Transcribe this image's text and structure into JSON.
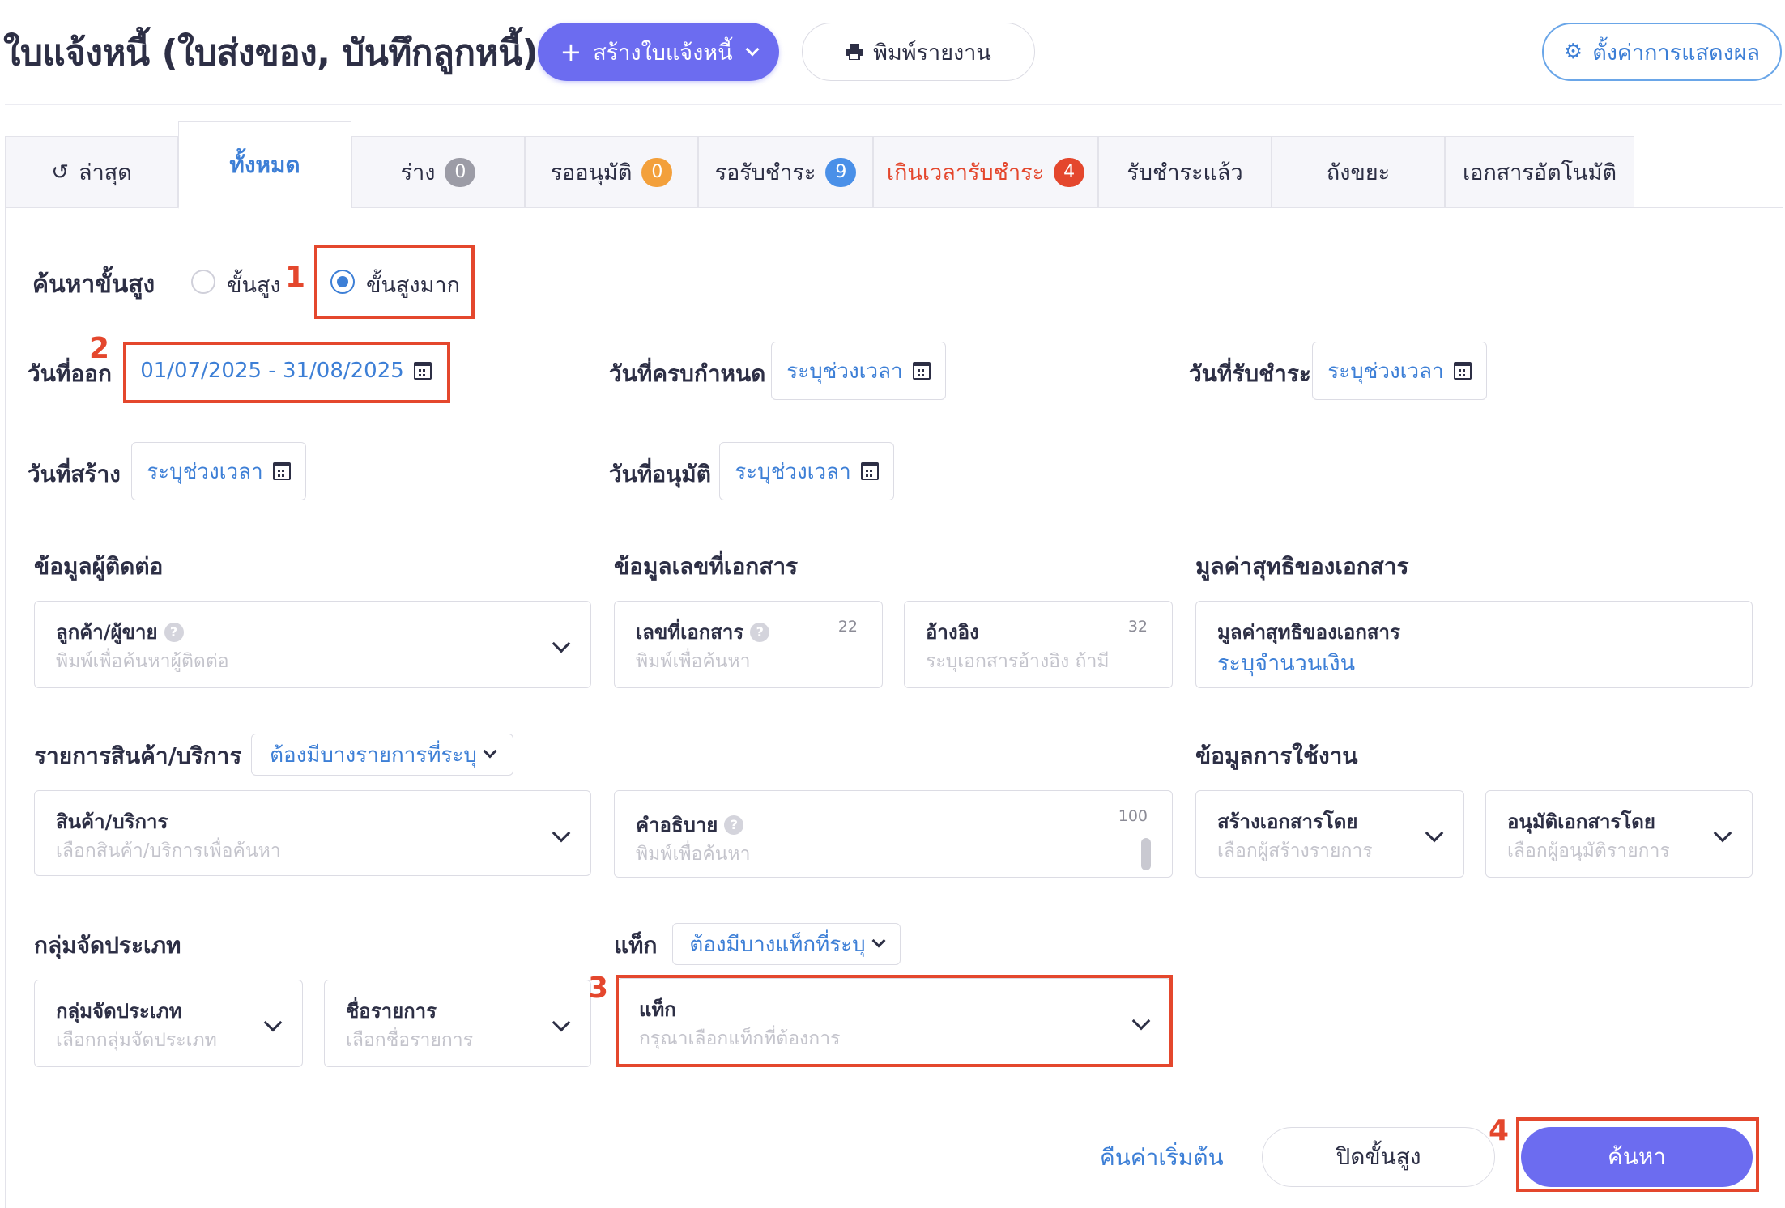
{
  "header": {
    "title": "ใบแจ้งหนี้ (ใบส่งของ, บันทึกลูกหนี้)",
    "create_button": "สร้างใบแจ้งหนี้",
    "print_button": "พิมพ์รายงาน",
    "display_settings_button": "ตั้งค่าการแสดงผล"
  },
  "tabs": [
    {
      "label": "ล่าสุด",
      "icon": "history-icon"
    },
    {
      "label": "ทั้งหมด",
      "active": true
    },
    {
      "label": "ร่าง",
      "badge": "0",
      "badge_color": "#9c9ca6"
    },
    {
      "label": "รออนุมัติ",
      "badge": "0",
      "badge_color": "#f3a03b"
    },
    {
      "label": "รอรับชำระ",
      "badge": "9",
      "badge_color": "#4a90e8"
    },
    {
      "label": "เกินเวลารับชำระ",
      "badge": "4",
      "badge_color": "#e4472d",
      "text_color": "#e4472d"
    },
    {
      "label": "รับชำระแล้ว"
    },
    {
      "label": "ถังขยะ"
    },
    {
      "label": "เอกสารอัตโนมัติ"
    }
  ],
  "search_mode": {
    "label": "ค้นหาขั้นสูง",
    "options": [
      {
        "label": "ขั้นสูง",
        "checked": false
      },
      {
        "label": "ขั้นสูงมาก",
        "checked": true
      }
    ]
  },
  "date_filters": {
    "issue_date": {
      "label": "วันที่ออก",
      "value": "01/07/2025 - 31/08/2025"
    },
    "due_date": {
      "label": "วันที่ครบกำหนด",
      "value": "ระบุช่วงเวลา"
    },
    "payment_date": {
      "label": "วันที่รับชำระ",
      "value": "ระบุช่วงเวลา"
    },
    "created_date": {
      "label": "วันที่สร้าง",
      "value": "ระบุช่วงเวลา"
    },
    "approved_date": {
      "label": "วันที่อนุมัติ",
      "value": "ระบุช่วงเวลา"
    }
  },
  "contact_section": {
    "title": "ข้อมูลผู้ติดต่อ",
    "field_label": "ลูกค้า/ผู้ขาย",
    "placeholder": "พิมพ์เพื่อค้นหาผู้ติดต่อ"
  },
  "doc_number_section": {
    "title": "ข้อมูลเลขที่เอกสาร",
    "doc_no_label": "เลขที่เอกสาร",
    "doc_no_count": "22",
    "doc_no_placeholder": "พิมพ์เพื่อค้นหา",
    "ref_label": "อ้างอิง",
    "ref_count": "32",
    "ref_placeholder": "ระบุเอกสารอ้างอิง ถ้ามี"
  },
  "net_value_section": {
    "title": "มูลค่าสุทธิของเอกสาร",
    "field_label": "มูลค่าสุทธิของเอกสาร",
    "value": "ระบุจำนวนเงิน"
  },
  "items_section": {
    "title": "รายการสินค้า/บริการ",
    "match_select": "ต้องมีบางรายการที่ระบุ",
    "product_label": "สินค้า/บริการ",
    "product_placeholder": "เลือกสินค้า/บริการเพื่อค้นหา",
    "desc_label": "คำอธิบาย",
    "desc_count": "100",
    "desc_placeholder": "พิมพ์เพื่อค้นหา"
  },
  "usage_section": {
    "title": "ข้อมูลการใช้งาน",
    "created_by_label": "สร้างเอกสารโดย",
    "created_by_placeholder": "เลือกผู้สร้างรายการ",
    "approved_by_label": "อนุมัติเอกสารโดย",
    "approved_by_placeholder": "เลือกผู้อนุมัติรายการ"
  },
  "category_section": {
    "title": "กลุ่มจัดประเภท",
    "group_label": "กลุ่มจัดประเภท",
    "group_placeholder": "เลือกกลุ่มจัดประเภท",
    "name_label": "ชื่อรายการ",
    "name_placeholder": "เลือกชื่อรายการ"
  },
  "tag_section": {
    "title": "แท็ก",
    "match_select": "ต้องมีบางแท็กที่ระบุ",
    "field_label": "แท็ก",
    "placeholder": "กรุณาเลือกแท็กที่ต้องการ"
  },
  "footer": {
    "reset_link": "คืนค่าเริ่มต้น",
    "close_button": "ปิดขั้นสูง",
    "search_button": "ค้นหา"
  },
  "annotations": [
    "1",
    "2",
    "3",
    "4"
  ],
  "colors": {
    "accent": "#6c6cf0",
    "link_blue": "#3d7fd6",
    "annotation_red": "#e4472d"
  }
}
